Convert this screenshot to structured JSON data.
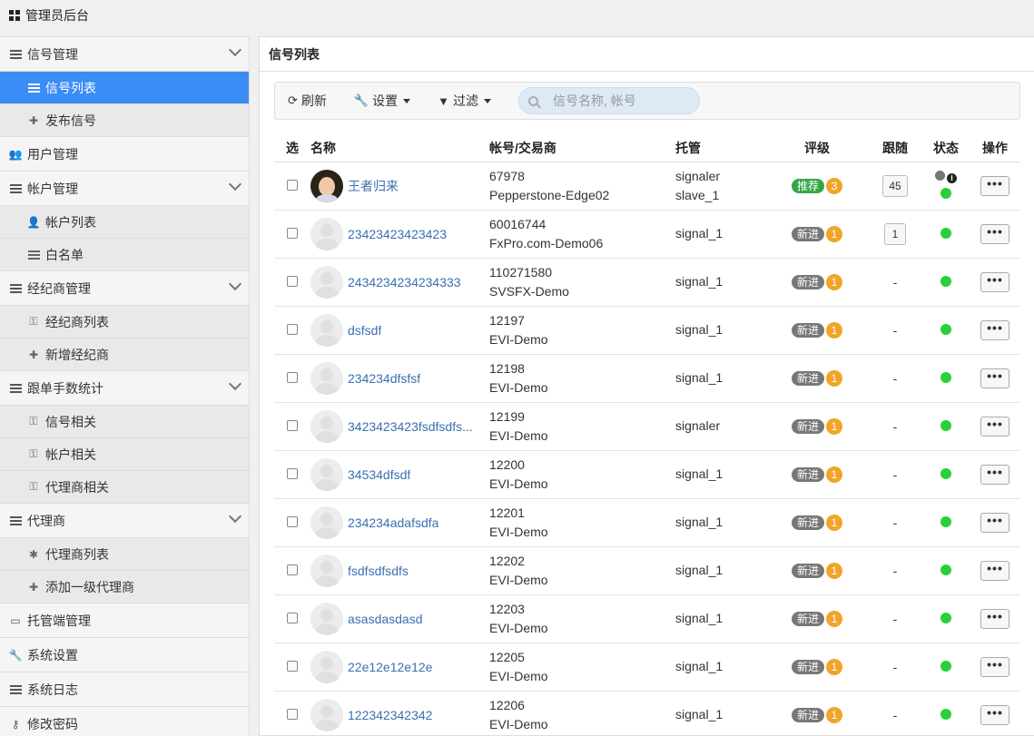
{
  "app": {
    "title": "管理员后台"
  },
  "sidebar": {
    "groups": [
      {
        "label": "信号管理",
        "children": [
          {
            "label": "信号列表",
            "active": true
          },
          {
            "label": "发布信号"
          }
        ]
      },
      {
        "label": "用户管理",
        "children": []
      },
      {
        "label": "帐户管理",
        "children": [
          {
            "label": "帐户列表"
          },
          {
            "label": "白名单"
          }
        ]
      },
      {
        "label": "经纪商管理",
        "children": [
          {
            "label": "经纪商列表"
          },
          {
            "label": "新增经纪商"
          }
        ]
      },
      {
        "label": "跟单手数统计",
        "children": [
          {
            "label": "信号相关"
          },
          {
            "label": "帐户相关"
          },
          {
            "label": "代理商相关"
          }
        ]
      },
      {
        "label": "代理商",
        "children": [
          {
            "label": "代理商列表"
          },
          {
            "label": "添加一级代理商"
          }
        ]
      },
      {
        "label": "托管端管理",
        "children": []
      },
      {
        "label": "系统设置",
        "children": []
      },
      {
        "label": "系统日志",
        "children": []
      },
      {
        "label": "修改密码",
        "children": []
      }
    ]
  },
  "panel": {
    "title": "信号列表"
  },
  "toolbar": {
    "refresh": "刷新",
    "settings": "设置",
    "filter": "过滤",
    "search_placeholder": "信号名称, 帐号"
  },
  "table": {
    "headers": {
      "select": "选",
      "name": "名称",
      "account": "帐号/交易商",
      "host": "托管",
      "rating": "评级",
      "follow": "跟随",
      "status": "状态",
      "ops": "操作"
    },
    "rows": [
      {
        "name": "王者归来",
        "account": "67978",
        "broker": "Pepperstone-Edge02",
        "host1": "signaler",
        "host2": "slave_1",
        "badge": "推荐",
        "level": "3",
        "follow": "45"
      },
      {
        "name": "23423423423423",
        "account": "60016744",
        "broker": "FxPro.com-Demo06",
        "host1": "signal_1",
        "host2": "",
        "badge": "新进",
        "level": "1",
        "follow": "1"
      },
      {
        "name": "2434234234234333",
        "account": "110271580",
        "broker": "SVSFX-Demo",
        "host1": "signal_1",
        "host2": "",
        "badge": "新进",
        "level": "1",
        "follow": "-"
      },
      {
        "name": "dsfsdf",
        "account": "12197",
        "broker": "EVI-Demo",
        "host1": "signal_1",
        "host2": "",
        "badge": "新进",
        "level": "1",
        "follow": "-"
      },
      {
        "name": "234234dfsfsf",
        "account": "12198",
        "broker": "EVI-Demo",
        "host1": "signal_1",
        "host2": "",
        "badge": "新进",
        "level": "1",
        "follow": "-"
      },
      {
        "name": "3423423423fsdfsdfs...",
        "account": "12199",
        "broker": "EVI-Demo",
        "host1": "signaler",
        "host2": "",
        "badge": "新进",
        "level": "1",
        "follow": "-"
      },
      {
        "name": "34534dfsdf",
        "account": "12200",
        "broker": "EVI-Demo",
        "host1": "signal_1",
        "host2": "",
        "badge": "新进",
        "level": "1",
        "follow": "-"
      },
      {
        "name": "234234adafsdfa",
        "account": "12201",
        "broker": "EVI-Demo",
        "host1": "signal_1",
        "host2": "",
        "badge": "新进",
        "level": "1",
        "follow": "-"
      },
      {
        "name": "fsdfsdfsdfs",
        "account": "12202",
        "broker": "EVI-Demo",
        "host1": "signal_1",
        "host2": "",
        "badge": "新进",
        "level": "1",
        "follow": "-"
      },
      {
        "name": "asasdasdasd",
        "account": "12203",
        "broker": "EVI-Demo",
        "host1": "signal_1",
        "host2": "",
        "badge": "新进",
        "level": "1",
        "follow": "-"
      },
      {
        "name": "22e12e12e12e",
        "account": "12205",
        "broker": "EVI-Demo",
        "host1": "signal_1",
        "host2": "",
        "badge": "新进",
        "level": "1",
        "follow": "-"
      },
      {
        "name": "122342342342",
        "account": "12206",
        "broker": "EVI-Demo",
        "host1": "signal_1",
        "host2": "",
        "badge": "新进",
        "level": "1",
        "follow": "-"
      }
    ],
    "ops_label": "•••",
    "info_glyph": "i"
  }
}
